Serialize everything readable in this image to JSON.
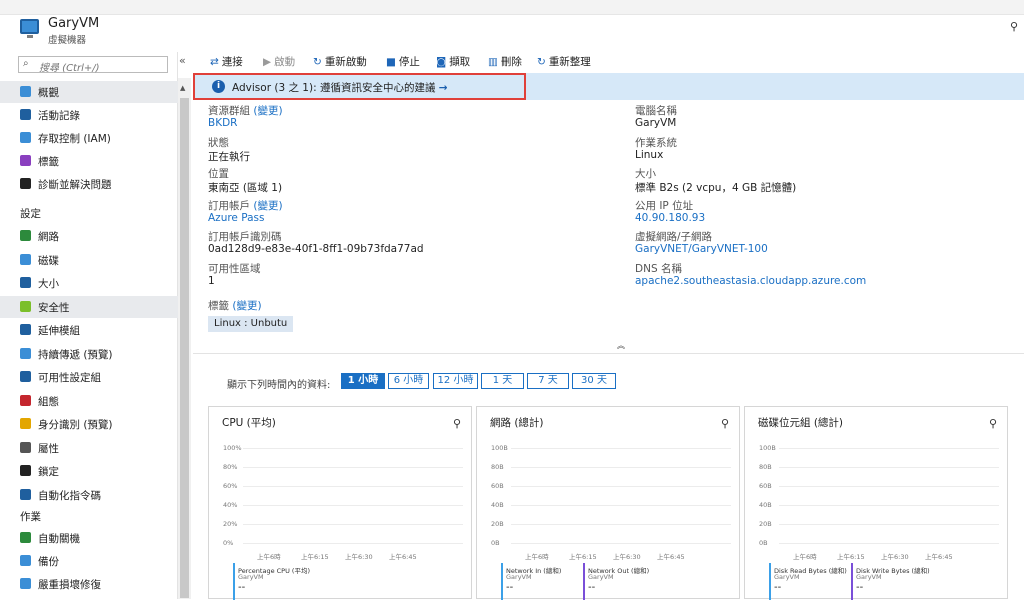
{
  "header": {
    "vm_name": "GaryVM",
    "vm_type": "虛擬機器",
    "pin": "⚲"
  },
  "search": {
    "placeholder": "搜尋 (Ctrl+/)",
    "collapse": "«"
  },
  "sidebar": {
    "items": [
      {
        "label": "概觀",
        "icon": "overview-icon",
        "color": "#3b8ed6"
      },
      {
        "label": "活動記錄",
        "icon": "activity-log-icon",
        "color": "#1f5f9e"
      },
      {
        "label": "存取控制 (IAM)",
        "icon": "iam-icon",
        "color": "#3b8ed6"
      },
      {
        "label": "標籤",
        "icon": "tag-icon",
        "color": "#8a3fbf"
      },
      {
        "label": "診斷並解決問題",
        "icon": "wrench-icon",
        "color": "#222222"
      }
    ],
    "settings_header": "設定",
    "settings": [
      {
        "label": "網路",
        "icon": "network-icon",
        "color": "#2c8a3c"
      },
      {
        "label": "磁碟",
        "icon": "disk-icon",
        "color": "#3b8ed6"
      },
      {
        "label": "大小",
        "icon": "size-icon",
        "color": "#1f5f9e"
      },
      {
        "label": "安全性",
        "icon": "shield-icon",
        "color": "#7bbf2a"
      },
      {
        "label": "延伸模組",
        "icon": "extensions-icon",
        "color": "#1f5f9e"
      },
      {
        "label": "持續傳遞 (預覽)",
        "icon": "continuous-delivery-icon",
        "color": "#3b8ed6"
      },
      {
        "label": "可用性設定組",
        "icon": "availability-set-icon",
        "color": "#1f5f9e"
      },
      {
        "label": "組態",
        "icon": "configuration-icon",
        "color": "#c4262e"
      },
      {
        "label": "身分識別 (預覽)",
        "icon": "identity-icon",
        "color": "#e3a600"
      },
      {
        "label": "屬性",
        "icon": "properties-icon",
        "color": "#555555"
      },
      {
        "label": "鎖定",
        "icon": "lock-icon",
        "color": "#222222"
      },
      {
        "label": "自動化指令碼",
        "icon": "automation-script-icon",
        "color": "#1f5f9e"
      }
    ],
    "ops_header": "作業",
    "ops": [
      {
        "label": "自動關機",
        "icon": "auto-shutdown-icon",
        "color": "#2c8a3c"
      },
      {
        "label": "備份",
        "icon": "backup-icon",
        "color": "#3b8ed6"
      },
      {
        "label": "嚴重損壞修復",
        "icon": "disaster-recovery-icon",
        "color": "#3b8ed6"
      }
    ]
  },
  "toolbar": [
    {
      "label": "連接",
      "icon": "connect-icon",
      "glyph": "⇄"
    },
    {
      "label": "啟動",
      "icon": "start-icon",
      "glyph": "▶"
    },
    {
      "label": "重新啟動",
      "icon": "restart-icon",
      "glyph": "↻"
    },
    {
      "label": "停止",
      "icon": "stop-icon",
      "glyph": "■"
    },
    {
      "label": "擷取",
      "icon": "capture-icon",
      "glyph": "◙"
    },
    {
      "label": "刪除",
      "icon": "delete-icon",
      "glyph": "▥"
    },
    {
      "label": "重新整理",
      "icon": "refresh-icon",
      "glyph": "↻"
    }
  ],
  "advisor": {
    "text": "Advisor (3 之 1): 遵循資訊安全中心的建議",
    "arrow": "→",
    "icon": "i"
  },
  "essentials": {
    "left": [
      {
        "label": "資源群組 ",
        "label_link": "(變更)",
        "value": "BKDR",
        "is_link": true
      },
      {
        "label": "狀態",
        "value": "正在執行",
        "is_link": false
      },
      {
        "label": "位置",
        "value": "東南亞 (區域 1)",
        "is_link": false
      },
      {
        "label": "訂用帳戶 ",
        "label_link": "(變更)",
        "value": "Azure Pass",
        "is_link": true
      },
      {
        "label": "訂用帳戶識別碼",
        "value": "0ad128d9-e83e-40f1-8ff1-09b73fda77ad",
        "is_link": false
      },
      {
        "label": "可用性區域",
        "value": "1",
        "is_link": false
      }
    ],
    "right": [
      {
        "label": "電腦名稱",
        "value": "GaryVM",
        "is_link": false
      },
      {
        "label": "作業系統",
        "value": "Linux",
        "is_link": false
      },
      {
        "label": "大小",
        "value": "標準 B2s (2 vcpu，4 GB 記憶體)",
        "is_link": false
      },
      {
        "label": "公用 IP 位址",
        "value": "40.90.180.93",
        "is_link": true
      },
      {
        "label": "虛擬網路/子網路",
        "value": "GaryVNET/GaryVNET-100",
        "is_link": true
      },
      {
        "label": "DNS 名稱",
        "value": "apache2.southeastasia.cloudapp.azure.com",
        "is_link": true
      }
    ],
    "tags_label": "標籤 ",
    "tags_link": "(變更)",
    "tag": "Linux : Unbutu",
    "collapse": "︽"
  },
  "time_range": {
    "label": "顯示下列時間內的資料:",
    "options": [
      "1 小時",
      "6 小時",
      "12 小時",
      "1 天",
      "7 天",
      "30 天"
    ],
    "selected": 0
  },
  "charts": [
    {
      "title": "CPU (平均)",
      "yticks": [
        "100%",
        "80%",
        "60%",
        "40%",
        "20%",
        "0%"
      ],
      "xticks": [
        "上午6時",
        "上午6:15",
        "上午6:30",
        "上午6:45"
      ],
      "legend": [
        {
          "name": "Percentage CPU (平均)",
          "sub": "GaryVM",
          "value": "--",
          "color": "#3ba0e8"
        }
      ]
    },
    {
      "title": "網路 (總計)",
      "yticks": [
        "100B",
        "80B",
        "60B",
        "40B",
        "20B",
        "0B"
      ],
      "xticks": [
        "上午6時",
        "上午6:15",
        "上午6:30",
        "上午6:45"
      ],
      "legend": [
        {
          "name": "Network In (總和)",
          "sub": "GaryVM",
          "value": "--",
          "color": "#3ba0e8"
        },
        {
          "name": "Network Out (總和)",
          "sub": "GaryVM",
          "value": "--",
          "color": "#7a4fd8"
        }
      ]
    },
    {
      "title": "磁碟位元組 (總計)",
      "yticks": [
        "100B",
        "80B",
        "60B",
        "40B",
        "20B",
        "0B"
      ],
      "xticks": [
        "上午6時",
        "上午6:15",
        "上午6:30",
        "上午6:45"
      ],
      "legend": [
        {
          "name": "Disk Read Bytes (總和)",
          "sub": "GaryVM",
          "value": "--",
          "color": "#3ba0e8"
        },
        {
          "name": "Disk Write Bytes (總和)",
          "sub": "GaryVM",
          "value": "--",
          "color": "#7a4fd8"
        }
      ]
    }
  ]
}
